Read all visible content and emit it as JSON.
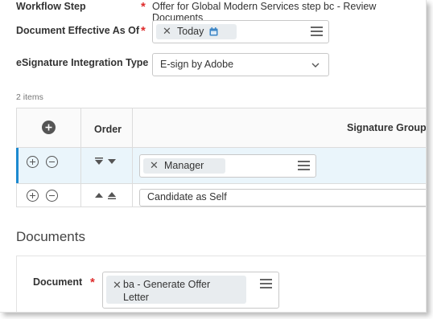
{
  "form": {
    "workflow_step": {
      "label": "Workflow Step",
      "value": "Offer for Global Modern Services step bc - Review Documents"
    },
    "effective_date": {
      "label": "Document Effective As Of",
      "value": "Today"
    },
    "esignature": {
      "label": "eSignature Integration Type",
      "value": "E-sign by Adobe"
    }
  },
  "table": {
    "item_count": "2 items",
    "columns": {
      "order": "Order",
      "signature_group": "Signature Group"
    },
    "rows": [
      {
        "signature_group": "Manager",
        "selected": true
      },
      {
        "signature_group": "Candidate as Self",
        "selected": false
      }
    ]
  },
  "documents": {
    "section_title": "Documents",
    "document_label": "Document",
    "document_value_line1": "ba - Generate Offer",
    "document_value_line2": "Letter"
  },
  "colors": {
    "required": "#de2c2c",
    "selected_row_bg": "#eaf5fb",
    "selected_row_border": "#1d8ad0",
    "pill_bg": "#e8ecef",
    "calendar_icon": "#3d86c6"
  },
  "icons": {
    "required": "asterisk",
    "clear": "close-icon",
    "prompt": "list-icon",
    "calendar": "calendar-icon",
    "add": "plus-circle-icon",
    "remove": "minus-circle-icon"
  }
}
